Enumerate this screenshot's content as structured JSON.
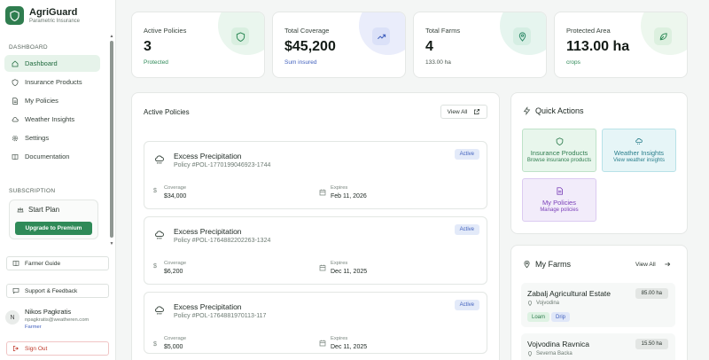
{
  "brand": {
    "name": "AgriGuard",
    "tagline": "Parametric Insurance"
  },
  "sidebar": {
    "section_dashboard": "DASHBOARD",
    "items": [
      {
        "label": "Dashboard",
        "icon": "home-icon"
      },
      {
        "label": "Insurance Products",
        "icon": "shield-icon"
      },
      {
        "label": "My Policies",
        "icon": "document-icon"
      },
      {
        "label": "Weather Insights",
        "icon": "cloud-icon"
      },
      {
        "label": "Settings",
        "icon": "gear-icon"
      },
      {
        "label": "Documentation",
        "icon": "book-icon"
      }
    ],
    "section_subscription": "SUBSCRIPTION",
    "plan": "Start Plan",
    "upgrade": "Upgrade to Premium",
    "guide": "Farmer Guide",
    "support": "Support & Feedback",
    "user": {
      "initial": "N",
      "name": "Nikos Pagkratis",
      "email": "npagkratis@weatheren.com",
      "role": "Farmer"
    },
    "signout": "Sign Out"
  },
  "stats": [
    {
      "label": "Active Policies",
      "value": "3",
      "sub": "Protected",
      "icon": "shield-icon"
    },
    {
      "label": "Total Coverage",
      "value": "$45,200",
      "sub": "Sum insured",
      "icon": "trending-up-icon"
    },
    {
      "label": "Total Farms",
      "value": "4",
      "sub": "133.00 ha",
      "icon": "location-pin-icon"
    },
    {
      "label": "Protected Area",
      "value": "113.00 ha",
      "sub": "crops",
      "icon": "leaf-icon"
    }
  ],
  "policies_panel": {
    "title": "Active Policies",
    "view_all": "View All",
    "coverage_label": "Coverage",
    "expires_label": "Expires",
    "items": [
      {
        "name": "Excess Precipitation",
        "id": "Policy #POL-1770199046923-1744",
        "status": "Active",
        "coverage": "$34,000",
        "expires": "Feb 11, 2026"
      },
      {
        "name": "Excess Precipitation",
        "id": "Policy #POL-1764882202263-1324",
        "status": "Active",
        "coverage": "$6,200",
        "expires": "Dec 11, 2025"
      },
      {
        "name": "Excess Precipitation",
        "id": "Policy #POL-1764881970113-117",
        "status": "Active",
        "coverage": "$5,000",
        "expires": "Dec 11, 2025"
      }
    ]
  },
  "quick_actions": {
    "title": "Quick Actions",
    "items": [
      {
        "title": "Insurance Products",
        "sub": "Browse insurance products"
      },
      {
        "title": "Weather Insights",
        "sub": "View weather insights"
      },
      {
        "title": "My Policies",
        "sub": "Manage policies"
      }
    ]
  },
  "farms": {
    "title": "My Farms",
    "view_all": "View All",
    "items": [
      {
        "name": "Zabalj Agricultural Estate",
        "location": "Vojvodina",
        "size": "85.00 ha",
        "crops": [
          "Loam",
          "Drip"
        ]
      },
      {
        "name": "Vojvodina Ravnica",
        "location": "Severna Backa",
        "size": "15.50 ha",
        "crops": []
      }
    ]
  },
  "colors": {
    "primary": "#2f8a58",
    "accent_blue": "#3f5fbd",
    "danger": "#c0392b"
  }
}
